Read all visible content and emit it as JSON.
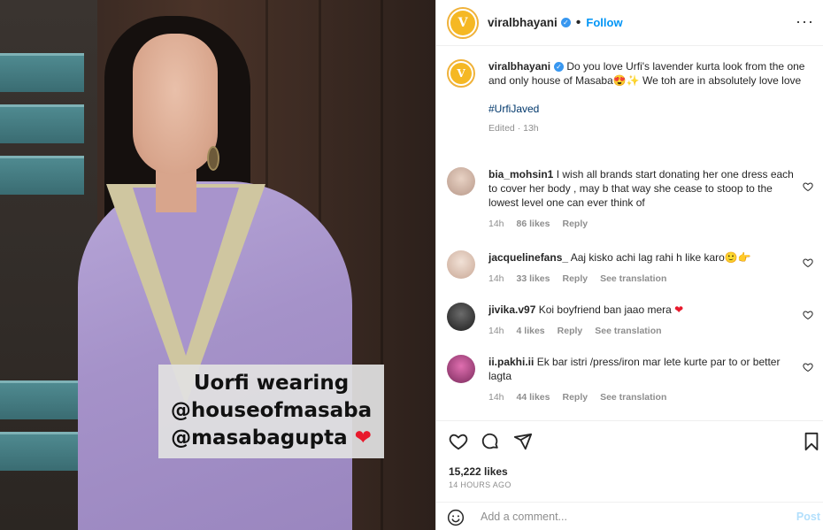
{
  "media": {
    "overlay_line1": "Uorfi wearing",
    "overlay_line2": "@houseofmasaba",
    "overlay_line3": "@masabagupta",
    "overlay_heart": "❤"
  },
  "header": {
    "username": "viralbhayani",
    "avatar_letter": "V",
    "separator": "•",
    "follow_label": "Follow",
    "more_label": "···"
  },
  "caption": {
    "username": "viralbhayani",
    "text": "Do you love Urfi's lavender kurta look from the one and only house of Masaba😍✨ We toh are in absolutely love love",
    "hashtag": "#UrfiJaved",
    "edited": "Edited · 13h"
  },
  "comments": [
    {
      "username": "bia_mohsin1",
      "text": "I wish all brands start donating her one dress each to cover her body , may b that way she cease to stoop to the lowest level one can ever think of",
      "time": "14h",
      "likes": "86 likes",
      "reply": "Reply",
      "translation": ""
    },
    {
      "username": "jacquelinefans_",
      "text": "Aaj kisko achi lag rahi h like karo🙂👉",
      "time": "14h",
      "likes": "33 likes",
      "reply": "Reply",
      "translation": "See translation"
    },
    {
      "username": "jivika.v97",
      "text": "Koi boyfriend ban jaao mera",
      "heart": "❤",
      "time": "14h",
      "likes": "4 likes",
      "reply": "Reply",
      "translation": "See translation"
    },
    {
      "username": "ii.pakhi.ii",
      "text": "Ek bar istri /press/iron mar lete kurte par to or better lagta",
      "time": "14h",
      "likes": "44 likes",
      "reply": "Reply",
      "translation": "See translation"
    }
  ],
  "footer": {
    "likes": "15,222 likes",
    "time_ago": "14 HOURS AGO",
    "comment_placeholder": "Add a comment...",
    "post_label": "Post"
  },
  "colors": {
    "accent": "#0095f6",
    "verified": "#3897f0",
    "heart": "#e8192c"
  }
}
